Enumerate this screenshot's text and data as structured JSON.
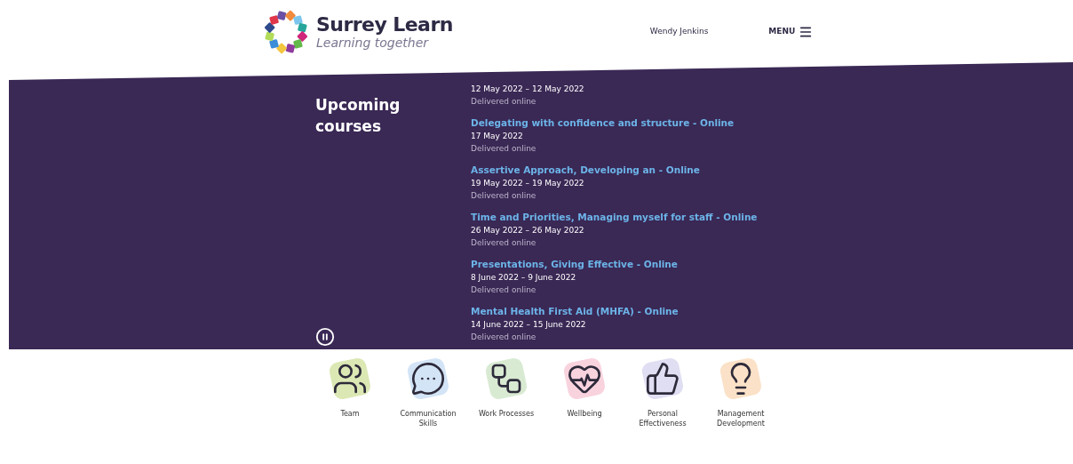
{
  "header": {
    "brand": "Surrey Learn",
    "tagline": "Learning together",
    "user": "Wendy Jenkins",
    "menu": "MENU"
  },
  "upcoming": {
    "heading": "Upcoming courses",
    "courses": [
      {
        "dates": "12 May 2022 – 12 May 2022",
        "delivery": "Delivered online"
      },
      {
        "title": "Delegating with confidence and structure - Online",
        "dates": "17 May 2022",
        "delivery": "Delivered online"
      },
      {
        "title": "Assertive Approach, Developing an - Online",
        "dates": "19 May 2022 – 19 May 2022",
        "delivery": "Delivered online"
      },
      {
        "title": "Time and Priorities, Managing myself for staff - Online",
        "dates": "26 May 2022 – 26 May 2022",
        "delivery": "Delivered online"
      },
      {
        "title": "Presentations, Giving Effective - Online",
        "dates": "8 June 2022 – 9 June 2022",
        "delivery": "Delivered online"
      },
      {
        "title": "Mental Health First Aid (MHFA) - Online",
        "dates": "14 June 2022 – 15 June 2022",
        "delivery": "Delivered online"
      }
    ]
  },
  "categories": [
    {
      "kind": "team",
      "label": "Team",
      "color": "#dbe8b4"
    },
    {
      "kind": "communication",
      "label": "Communication Skills",
      "color": "#d3e4f6"
    },
    {
      "kind": "process",
      "label": "Work Processes",
      "color": "#d9ead3"
    },
    {
      "kind": "wellbeing",
      "label": "Wellbeing",
      "color": "#f8d3de"
    },
    {
      "kind": "effectiveness",
      "label": "Personal Effectiveness",
      "color": "#e0def2"
    },
    {
      "kind": "management",
      "label": "Management Development",
      "color": "#fbe1c7"
    }
  ]
}
